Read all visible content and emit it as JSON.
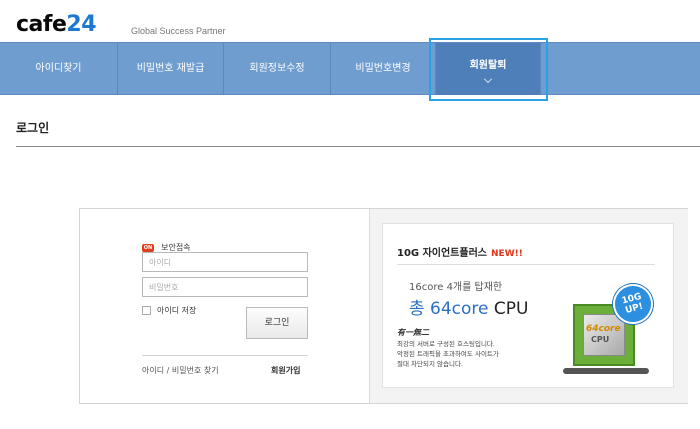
{
  "header": {
    "logo_part1": "cafe",
    "logo_part2": "24",
    "tagline": "Global Success Partner"
  },
  "nav": {
    "items": [
      {
        "label": "아이디찾기"
      },
      {
        "label": "비밀번호 재발급"
      },
      {
        "label": "회원정보수정"
      },
      {
        "label": "비밀번호변경"
      },
      {
        "label": "회원탈퇴"
      }
    ],
    "active_index": 4
  },
  "page": {
    "title": "로그인"
  },
  "login": {
    "secure_badge": "ON",
    "secure_label": "보안접속",
    "id_placeholder": "아이디",
    "pw_placeholder": "비밀번호",
    "save_id_label": "아이디 저장",
    "login_button": "로그인",
    "find_link": "아이디 / 비밀번호 찾기",
    "join_link": "회원가입"
  },
  "banner": {
    "heading": "10G 자이언트플러스",
    "new_tag": "NEW!!",
    "line1": "16core 4개를 탑재한",
    "line2_prefix": "총 64core",
    "line2_suffix": "CPU",
    "motto": "有一無二",
    "desc": [
      "최강의 서버로 구성된 호스팅입니다.",
      "악정된 트래픽을 초과하여도 사이트가",
      "절대 차단되지 않습니다."
    ],
    "chip_text1": "64core",
    "chip_text2": "CPU",
    "badge_line1": "10G",
    "badge_line2": "UP!"
  },
  "colors": {
    "nav_bg": "#6f9dd0",
    "nav_active": "#4f7fb8",
    "highlight": "#29a3e6",
    "accent_blue": "#2a6fc0",
    "new_red": "#e0361a"
  }
}
